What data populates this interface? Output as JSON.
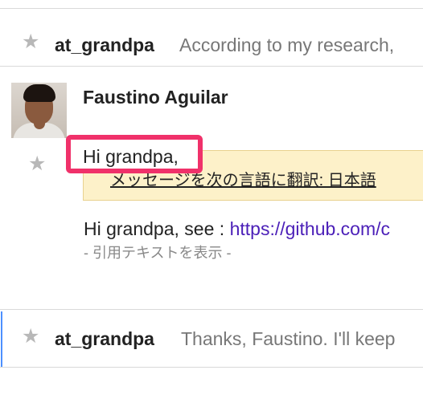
{
  "thread": [
    {
      "sender": "at_grandpa",
      "snippet": "According to my research, "
    },
    {
      "sender": "Faustino Aguilar",
      "translate_link": "メッセージを次の言語に翻訳: 日本語",
      "body_text": "Hi grandpa,",
      "body_rest": " see : ",
      "body_link": "https://github.com/c",
      "quoted_toggle": "- 引用テキストを表示 -"
    },
    {
      "sender": "at_grandpa",
      "snippet": "Thanks, Faustino. I'll keep"
    }
  ],
  "highlight_text": "Hi grandpa,",
  "colors": {
    "star": "#b8b8b8",
    "translate_bg": "#fdf1c9",
    "link": "#4b1fb8",
    "highlight_border": "#f0316a",
    "row_accent": "#4d90fe"
  }
}
